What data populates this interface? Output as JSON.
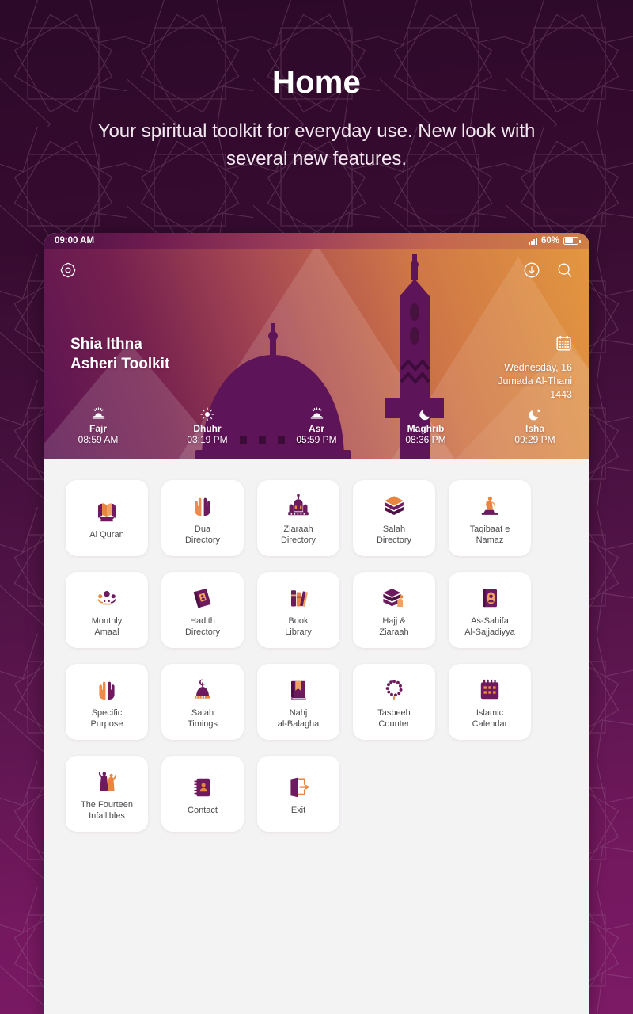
{
  "promo": {
    "title": "Home",
    "subtitle": "Your spiritual toolkit for everyday use. New look with several new features."
  },
  "colors": {
    "brand_purple": "#5e1350",
    "brand_orange": "#e3973f",
    "deep_plum": "#2c0928",
    "tile_bg": "#ffffff",
    "screen_bg": "#f4f3f4",
    "icon_purple": "#6d1a5e",
    "icon_orange": "#e8853f"
  },
  "statusbar": {
    "time": "09:00 AM",
    "battery_percent": "60%",
    "signal_icon": "signal-bars-icon",
    "battery_icon": "battery-icon"
  },
  "header": {
    "qibla_icon": "qibla-compass-icon",
    "download_icon": "download-icon",
    "search_icon": "search-icon",
    "app_title_line1": "Shia Ithna",
    "app_title_line2": "Asheri Toolkit",
    "calendar_icon": "calendar-icon",
    "date_line1": "Wednesday, 16",
    "date_line2": "Jumada Al-Thani",
    "date_line3": "1443"
  },
  "prayers": [
    {
      "name": "Fajr",
      "time": "08:59 AM",
      "icon": "sunrise-icon"
    },
    {
      "name": "Dhuhr",
      "time": "03:19 PM",
      "icon": "sun-icon"
    },
    {
      "name": "Asr",
      "time": "05:59 PM",
      "icon": "sunset-icon"
    },
    {
      "name": "Maghrib",
      "time": "08:36 PM",
      "icon": "moon-icon"
    },
    {
      "name": "Isha",
      "time": "09:29 PM",
      "icon": "moon-star-icon"
    }
  ],
  "tiles": [
    {
      "label": "Al Quran",
      "icon": "quran-book-icon"
    },
    {
      "label": "Dua\nDirectory",
      "icon": "praying-hands-icon"
    },
    {
      "label": "Ziaraah\nDirectory",
      "icon": "shrine-icon"
    },
    {
      "label": "Salah\nDirectory",
      "icon": "kaaba-icon"
    },
    {
      "label": "Taqibaat e\nNamaz",
      "icon": "kneeling-person-icon"
    },
    {
      "label": "Monthly\nAmaal",
      "icon": "moon-phases-icon"
    },
    {
      "label": "Hadith\nDirectory",
      "icon": "closed-book-icon"
    },
    {
      "label": "Book\nLibrary",
      "icon": "books-shelf-icon"
    },
    {
      "label": "Hajj &\nZiaraah",
      "icon": "kaaba-pilgrim-icon"
    },
    {
      "label": "As-Sahifa\nAl-Sajjadiyya",
      "icon": "sahifa-book-icon"
    },
    {
      "label": "Specific\nPurpose",
      "icon": "praying-hands-icon"
    },
    {
      "label": "Salah\nTimings",
      "icon": "dome-clock-icon"
    },
    {
      "label": "Nahj\nal-Balagha",
      "icon": "bookmark-book-icon"
    },
    {
      "label": "Tasbeeh\nCounter",
      "icon": "prayer-beads-icon"
    },
    {
      "label": "Islamic\nCalendar",
      "icon": "calendar-grid-icon"
    },
    {
      "label": "The Fourteen\nInfallibles",
      "icon": "fourteen-figures-icon"
    },
    {
      "label": "Contact",
      "icon": "contact-book-icon"
    },
    {
      "label": "Exit",
      "icon": "exit-door-icon"
    }
  ]
}
